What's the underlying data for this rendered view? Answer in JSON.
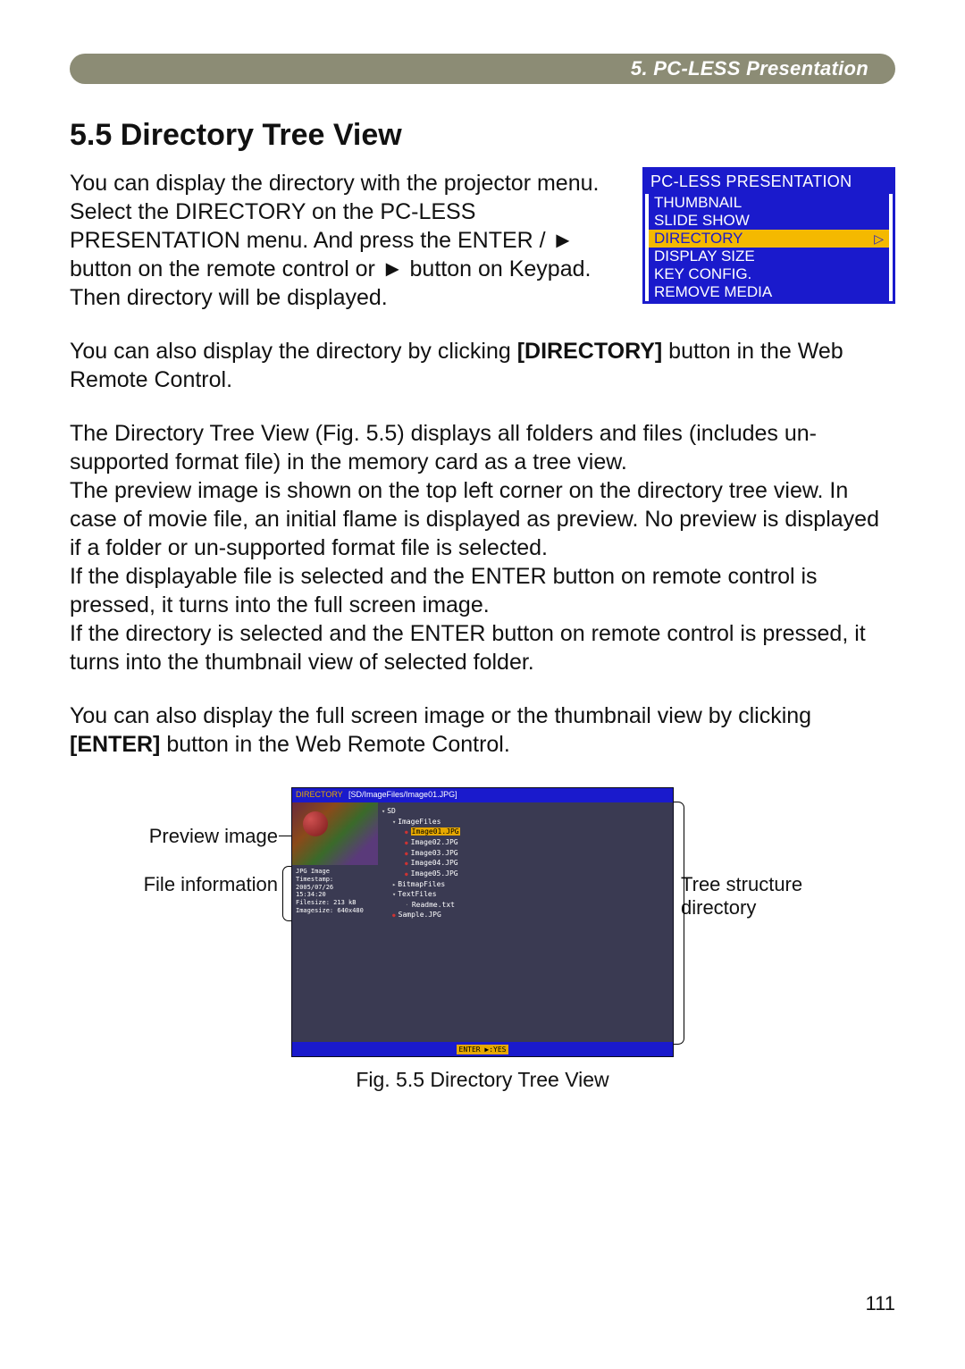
{
  "header": {
    "chapter": "5. PC-LESS Presentation"
  },
  "section": {
    "title": "5.5 Directory Tree View"
  },
  "menu": {
    "title": "PC-LESS PRESENTATION",
    "items": [
      {
        "label": "THUMBNAIL",
        "selected": false
      },
      {
        "label": "SLIDE SHOW",
        "selected": false
      },
      {
        "label": "DIRECTORY",
        "selected": true
      },
      {
        "label": "DISPLAY SIZE",
        "selected": false
      },
      {
        "label": "KEY CONFIG.",
        "selected": false
      },
      {
        "label": "REMOVE MEDIA",
        "selected": false
      }
    ]
  },
  "paras": {
    "p1_a": "You can display the directory with the projector menu. Select the DIRECTORY on the PC-LESS PRESENTATION menu. And press the ENTER / ► button on the remote control or ► button on Keypad. Then directory will be displayed.",
    "p2_a": "You can also display the directory by clicking ",
    "p2_b": "[DIRECTORY]",
    "p2_c": " button in the Web Remote Control.",
    "p3": "The Directory Tree View (Fig. 5.5) displays all folders and files (includes un-supported format file) in the memory card as a tree view.",
    "p4": "The preview image is shown on the top left corner on the directory tree view. In case of movie file, an initial flame is displayed as preview. No preview is displayed if a folder or un-supported format file is selected.",
    "p5": "If the displayable file is selected and the ENTER button on remote control is pressed, it turns into the full screen image.",
    "p6": "If the directory is selected and the ENTER button on remote control is pressed, it turns into the thumbnail view of selected folder.",
    "p7_a": "You can also display the full screen image or the thumbnail view by clicking ",
    "p7_b": "[ENTER]",
    "p7_c": " button in the Web Remote Control."
  },
  "callouts": {
    "preview": "Preview image",
    "fileinfo": "File information",
    "tree": "Tree structure directory"
  },
  "dirview": {
    "top_label": "DIRECTORY",
    "top_path": "[SD/ImageFiles/Image01.JPG]",
    "fileinfo": {
      "l1": "JPG Image",
      "l2": "Timestamp:",
      "l3": "2005/07/26",
      "l4": "15:34:20",
      "l5": "Filesize: 213 kB",
      "l6": "Imagesize: 640x480"
    },
    "tree": {
      "root": "SD",
      "folder1": "ImageFiles",
      "f1": "Image01.JPG",
      "f2": "Image02.JPG",
      "f3": "Image03.JPG",
      "f4": "Image04.JPG",
      "f5": "Image05.JPG",
      "folder2": "BitmapFiles",
      "folder3": "TextFiles",
      "t1": "Readme.txt",
      "s1": "Sample.JPG"
    },
    "bottom": "ENTER ▶:YES"
  },
  "caption": "Fig. 5.5 Directory Tree View",
  "pagenum": "111"
}
